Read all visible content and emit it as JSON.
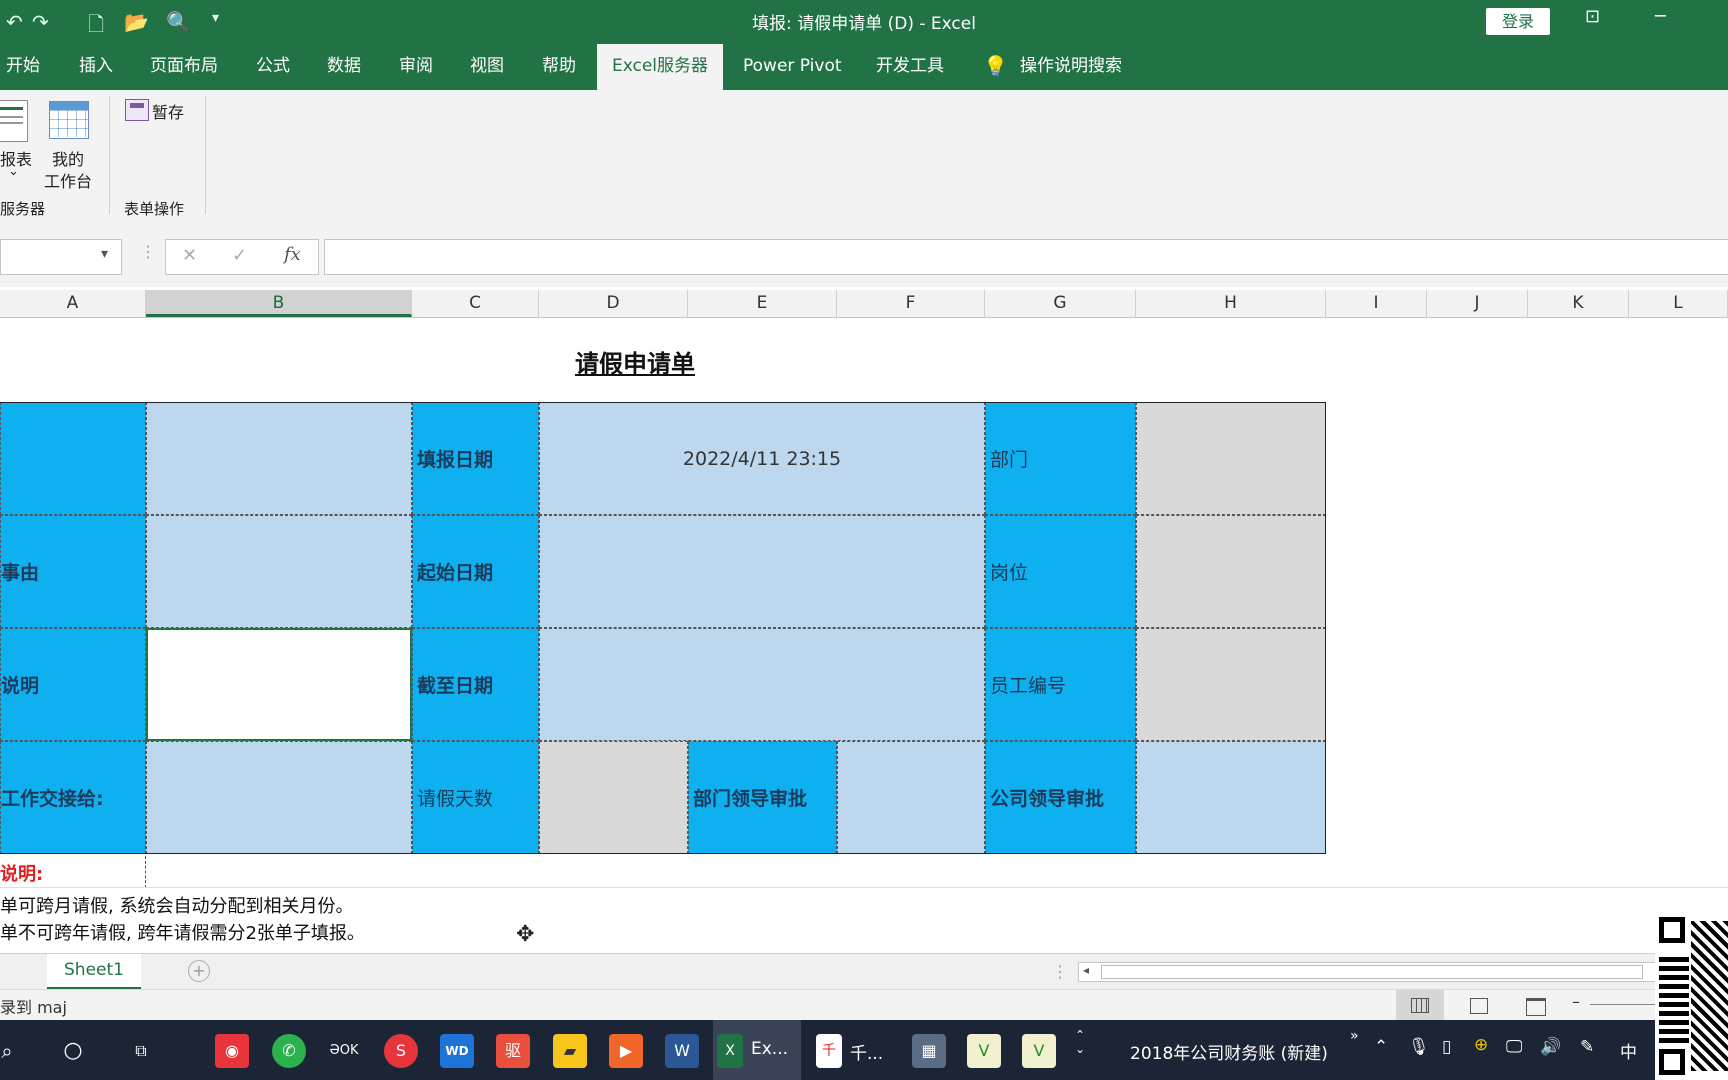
{
  "window": {
    "title": "填报: 请假申请单 (D)  -  Excel",
    "login_label": "登录",
    "minimize": "─",
    "restore": "⊡"
  },
  "ribbon_tabs": [
    {
      "label": "开始"
    },
    {
      "label": "插入"
    },
    {
      "label": "页面布局"
    },
    {
      "label": "公式"
    },
    {
      "label": "数据"
    },
    {
      "label": "审阅"
    },
    {
      "label": "视图"
    },
    {
      "label": "帮助"
    },
    {
      "label": "Excel服务器"
    },
    {
      "label": "Power Pivot"
    },
    {
      "label": "开发工具"
    }
  ],
  "search_label": "操作说明搜索",
  "ribbon": {
    "report_label": "报表",
    "report_arrow": "⌄",
    "workbench_label_1": "我的",
    "workbench_label_2": "工作台",
    "save_draft_label": "暂存",
    "group_server": "服务器",
    "group_form_ops": "表单操作"
  },
  "formula_bar": {
    "cancel": "✕",
    "confirm": "✓",
    "fx": "fx",
    "namebox_arrow": "▾",
    "value": ""
  },
  "columns": [
    "A",
    "B",
    "C",
    "D",
    "E",
    "F",
    "G",
    "H",
    "I",
    "J",
    "K",
    "L"
  ],
  "form": {
    "title": "请假申请单",
    "fill_date_label": "填报日期",
    "fill_date_value": "2022/4/11 23:15",
    "dept_label": "部门",
    "reason_label": "事由",
    "start_date_label": "起始日期",
    "position_label": "岗位",
    "desc_label": "说明",
    "end_date_label": "截至日期",
    "emp_no_label": "员工编号",
    "handover_label": "工作交接给:",
    "days_label": "请假天数",
    "dept_approve_label": "部门领导审批",
    "company_approve_label": "公司领导审批"
  },
  "notes": {
    "heading": "说明:",
    "line1": "单可跨月请假, 系统会自动分配到相关月份。",
    "line2": "单不可跨年请假, 跨年请假需分2张单子填报。"
  },
  "sheet_tab": "Sheet1",
  "status_text": "录到 maj",
  "taskbar": {
    "excel_label": "Ex...",
    "app_label": "千...",
    "tray_text": "2018年公司财务账 (新建)",
    "ime": "中"
  },
  "colors": {
    "excel_green": "#217346",
    "header_blue": "#0FB0F0",
    "field_light_blue": "#BDD7EE",
    "field_gray": "#D9D9D9",
    "note_red": "#E02020"
  }
}
